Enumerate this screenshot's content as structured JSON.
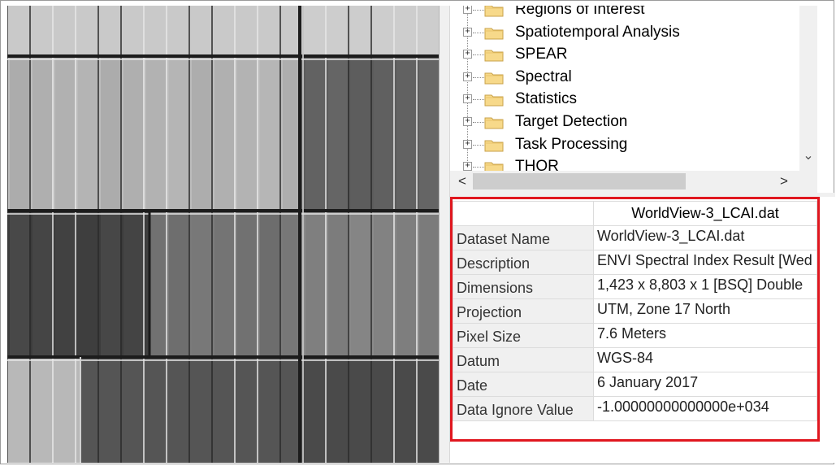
{
  "toolbox": {
    "items": [
      {
        "label": "Regions of Interest"
      },
      {
        "label": "Spatiotemporal Analysis"
      },
      {
        "label": "SPEAR"
      },
      {
        "label": "Spectral"
      },
      {
        "label": "Statistics"
      },
      {
        "label": "Target Detection"
      },
      {
        "label": "Task Processing"
      },
      {
        "label": "THOR"
      }
    ],
    "expander_symbol": "+",
    "icon": "folder-icon"
  },
  "scrollbars": {
    "left_arrow": "<",
    "right_arrow": ">",
    "down_arrow": "⌄"
  },
  "metadata": {
    "header": "WorldView-3_LCAI.dat",
    "rows": [
      {
        "key": "Dataset Name",
        "value": "WorldView-3_LCAI.dat"
      },
      {
        "key": "Description",
        "value": "ENVI Spectral Index Result [Wed"
      },
      {
        "key": "Dimensions",
        "value": "1,423 x 8,803 x 1 [BSQ] Double"
      },
      {
        "key": "Projection",
        "value": "UTM, Zone 17 North"
      },
      {
        "key": "Pixel Size",
        "value": "7.6 Meters"
      },
      {
        "key": "Datum",
        "value": "WGS-84"
      },
      {
        "key": "Date",
        "value": "6 January 2017"
      },
      {
        "key": "Data Ignore Value",
        "value": "-1.00000000000000e+034"
      }
    ]
  },
  "colors": {
    "highlight": "#e0171f",
    "folder": "#f7d98a",
    "panel_bg": "#f0f0f0"
  }
}
